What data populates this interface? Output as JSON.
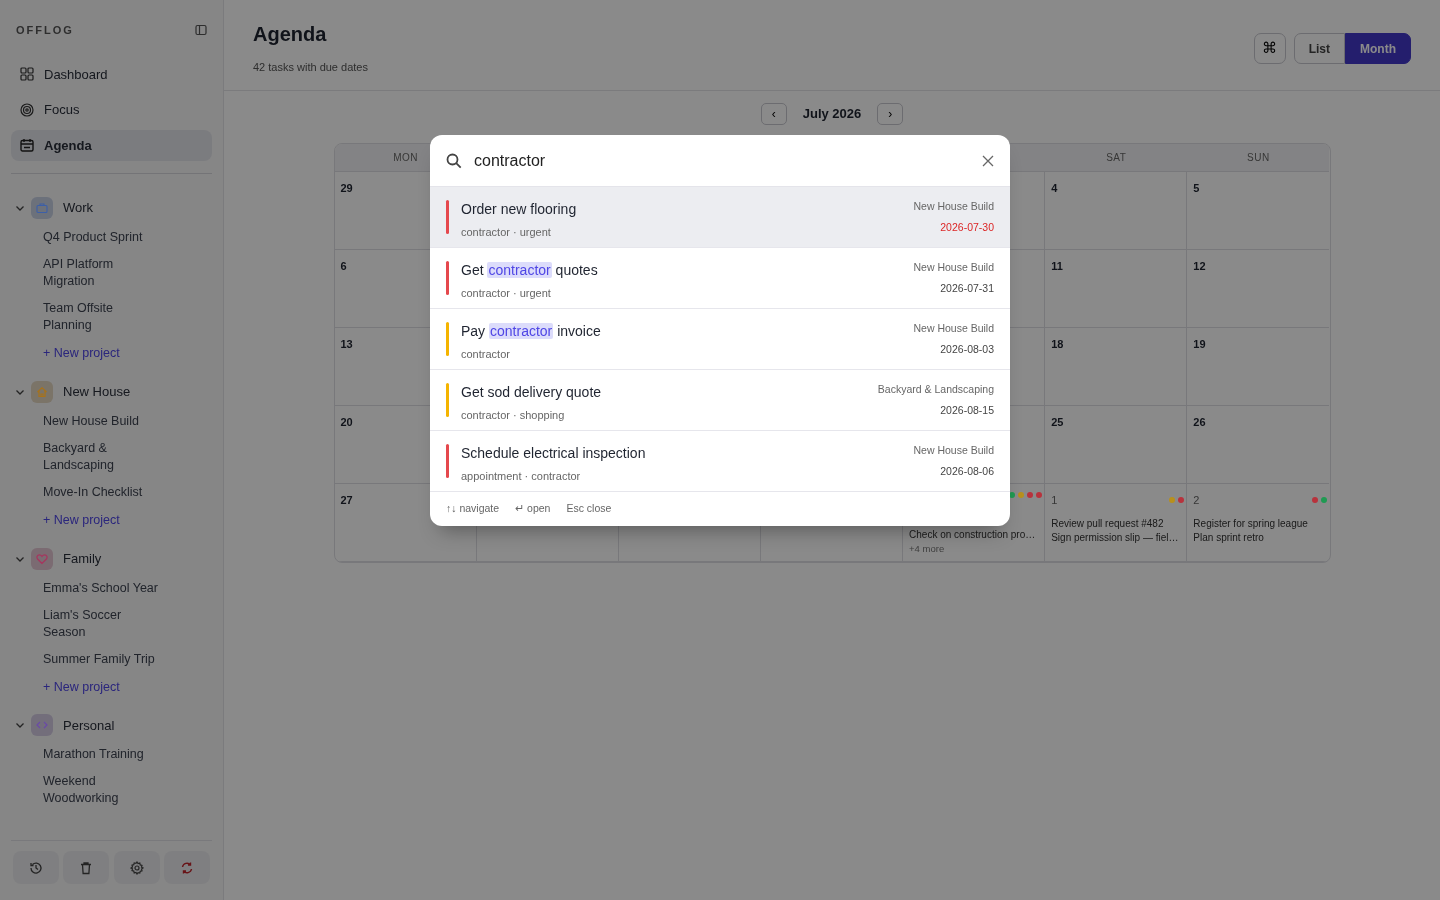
{
  "sidebar": {
    "brand": "OFFLOG",
    "nav": [
      {
        "label": "Dashboard",
        "selected": false
      },
      {
        "label": "Focus",
        "selected": false
      },
      {
        "label": "Agenda",
        "selected": true
      }
    ],
    "groups": [
      {
        "name": "Work",
        "color": "#3c5fa8",
        "expanded": true,
        "projects": [
          "Q4 Product Sprint",
          "API Platform Migration",
          "Team Offsite Planning"
        ],
        "new_project": "+ New project"
      },
      {
        "name": "New House",
        "color": "#a8721a",
        "expanded": true,
        "projects": [
          "New House Build",
          "Backyard & Landscaping",
          "Move-In Checklist"
        ],
        "new_project": "+ New project"
      },
      {
        "name": "Family",
        "color": "#a8345e",
        "expanded": true,
        "projects": [
          "Emma's School Year",
          "Liam's Soccer Season",
          "Summer Family Trip"
        ],
        "new_project": "+ New project"
      },
      {
        "name": "Personal",
        "color": "#6a4aa8",
        "expanded": true,
        "projects": [
          "Marathon Training",
          "Weekend Woodworking"
        ]
      }
    ]
  },
  "header": {
    "title": "Agenda",
    "subtitle": "42 tasks with due dates",
    "command_key": "⌘",
    "views": [
      {
        "label": "List",
        "selected": false
      },
      {
        "label": "Month",
        "selected": true
      }
    ]
  },
  "calendar": {
    "prev": "‹",
    "month": "July 2026",
    "next": "›",
    "weekdays": {
      "mon": "MON",
      "sat": "SAT",
      "sun": "SUN"
    },
    "weeks": [
      {
        "mon": {
          "day": "29"
        },
        "sat": {
          "day": "4"
        },
        "sun": {
          "day": "5"
        }
      },
      {
        "mon": {
          "day": "6"
        },
        "sat": {
          "day": "11"
        },
        "sun": {
          "day": "12"
        }
      },
      {
        "mon": {
          "day": "13"
        },
        "sat": {
          "day": "18"
        },
        "sun": {
          "day": "19"
        }
      },
      {
        "mon": {
          "day": "20"
        },
        "sat": {
          "day": "25"
        },
        "sun": {
          "day": "26"
        }
      },
      {
        "mon": {
          "day": "27"
        },
        "fri": {
          "dots": [
            {
              "color": "#1f9a52"
            },
            {
              "color": "#b8901c"
            },
            {
              "color": "#b8323c"
            },
            {
              "color": "#b8323c"
            }
          ],
          "tasks": [
            "Check on construction pro…"
          ],
          "more": "+4 more"
        },
        "sat": {
          "day": "1",
          "outside": true,
          "dots": [
            {
              "color": "#b8901c"
            },
            {
              "color": "#b8323c"
            }
          ],
          "tasks": [
            "Review pull request #482",
            "Sign permission slip — fiel…"
          ]
        },
        "sun": {
          "day": "2",
          "outside": true,
          "dots": [
            {
              "color": "#b8323c"
            },
            {
              "color": "#1f9a52"
            }
          ],
          "tasks": [
            "Register for spring league",
            "Plan sprint retro"
          ]
        }
      }
    ]
  },
  "search": {
    "query": "contractor",
    "results": [
      {
        "title_parts": [
          {
            "text": "Order new flooring",
            "match": false
          }
        ],
        "tags": "contractor · urgent",
        "project": "New House Build",
        "date": "2026-07-30",
        "overdue": true,
        "color": "#e5484d",
        "selected": true
      },
      {
        "title_parts": [
          {
            "text": "Get ",
            "match": false
          },
          {
            "text": "contractor",
            "match": true
          },
          {
            "text": " quotes",
            "match": false
          }
        ],
        "tags": "contractor · urgent",
        "project": "New House Build",
        "date": "2026-07-31",
        "overdue": false,
        "color": "#e5484d",
        "selected": false
      },
      {
        "title_parts": [
          {
            "text": "Pay ",
            "match": false
          },
          {
            "text": "contractor",
            "match": true
          },
          {
            "text": " invoice",
            "match": false
          }
        ],
        "tags": "contractor",
        "project": "New House Build",
        "date": "2026-08-03",
        "overdue": false,
        "color": "#f5b400",
        "selected": false
      },
      {
        "title_parts": [
          {
            "text": "Get sod delivery quote",
            "match": false
          }
        ],
        "tags": "contractor · shopping",
        "project": "Backyard & Landscaping",
        "date": "2026-08-15",
        "overdue": false,
        "color": "#f5b400",
        "selected": false
      },
      {
        "title_parts": [
          {
            "text": "Schedule electrical inspection",
            "match": false
          }
        ],
        "tags": "appointment · contractor",
        "project": "New House Build",
        "date": "2026-08-06",
        "overdue": false,
        "color": "#e5484d",
        "selected": false
      }
    ],
    "hints": [
      "↑↓ navigate",
      "↵ open",
      "Esc close"
    ]
  }
}
